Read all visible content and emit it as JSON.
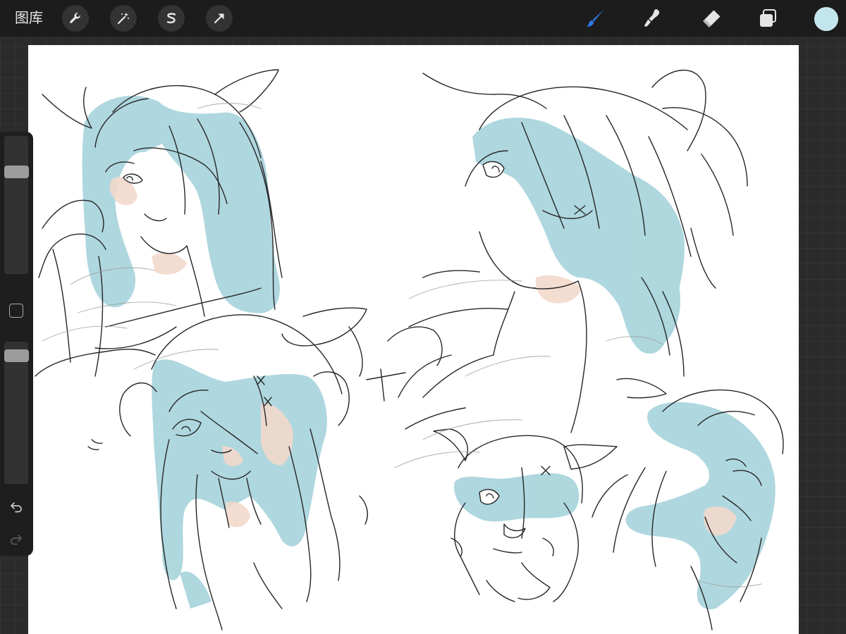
{
  "toolbar": {
    "gallery_label": "图库",
    "left_tools": [
      {
        "name": "adjustments",
        "icon": "wrench-icon"
      },
      {
        "name": "adjustments-magic",
        "icon": "magic-wand-icon"
      },
      {
        "name": "selection",
        "icon": "selection-s-icon"
      },
      {
        "name": "transform",
        "icon": "cursor-arrow-icon"
      }
    ],
    "right_tools": [
      {
        "name": "brush",
        "icon": "brush-icon",
        "active": true
      },
      {
        "name": "smudge",
        "icon": "smudge-icon",
        "active": false
      },
      {
        "name": "eraser",
        "icon": "eraser-icon",
        "active": false
      },
      {
        "name": "layers",
        "icon": "layers-icon",
        "active": false
      }
    ],
    "current_color": "#c3e6ec"
  },
  "colors": {
    "accent_active": "#2f7be8",
    "sketch_fill_blue": "#a8d4dc",
    "sketch_fill_skin": "#f2d9cc"
  },
  "sidebar": {
    "brush_size_level": 0.77,
    "brush_opacity_level": 0.95,
    "controls": [
      "brush-size-slider",
      "modify-button",
      "brush-opacity-slider",
      "undo-button",
      "redo-button"
    ]
  }
}
